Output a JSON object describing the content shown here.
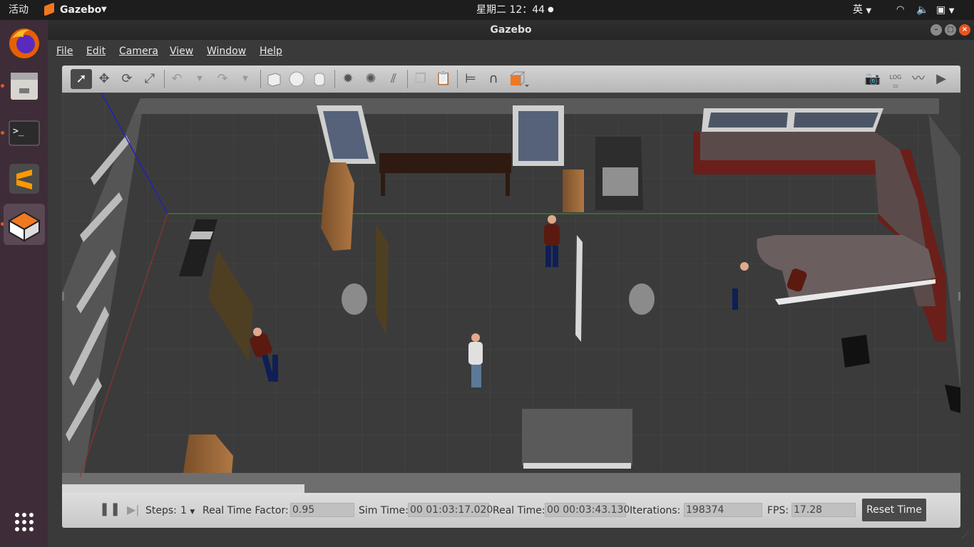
{
  "topbar": {
    "activities": "活动",
    "app_name": "Gazebo",
    "clock": "星期二 12：44",
    "input_method": "英"
  },
  "window": {
    "title": "Gazebo"
  },
  "menu": {
    "file": "File",
    "edit": "Edit",
    "camera": "Camera",
    "view": "View",
    "window": "Window",
    "help": "Help"
  },
  "toolbar": {
    "tools": [
      "select-mode",
      "translate-mode",
      "rotate-mode",
      "scale-mode",
      "undo",
      "redo",
      "box",
      "sphere",
      "cylinder",
      "point-light",
      "spot-light",
      "directional-light",
      "copy",
      "paste",
      "align",
      "snap",
      "view-angle",
      "screenshot",
      "log",
      "plot",
      "record"
    ],
    "log_label": "LOG",
    "accent_color": "#f07820"
  },
  "status": {
    "steps_label": "Steps:",
    "steps_value": "1",
    "rtf_label": "Real Time Factor:",
    "rtf_value": "0.95",
    "sim_time_label": "Sim Time:",
    "sim_time_value": "00 01:03:17.020",
    "real_time_label": "Real Time:",
    "real_time_value": "00 00:03:43.130",
    "iterations_label": "Iterations:",
    "iterations_value": "198374",
    "fps_label": "FPS:",
    "fps_value": "17.28",
    "reset_label": "Reset Time"
  },
  "dock": {
    "apps": [
      "firefox-icon",
      "files-icon",
      "terminal-icon",
      "sublime-icon",
      "gazebo-icon"
    ]
  }
}
